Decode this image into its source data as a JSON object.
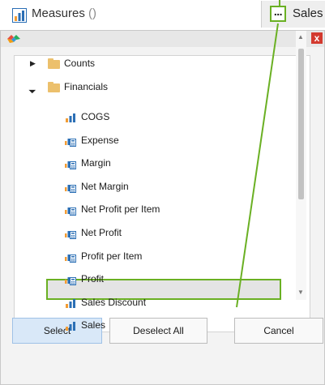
{
  "topbar": {
    "measures_label": "Measures",
    "measures_count": "()",
    "ellipsis": "...",
    "sales_tab_label": "Sales"
  },
  "dialog": {
    "close_glyph": "x",
    "tree": {
      "counts_label": "Counts",
      "financials_label": "Financials",
      "items": [
        {
          "label": "COGS",
          "icon": "bar-chart-icon"
        },
        {
          "label": "Expense",
          "icon": "calculated-measure-icon"
        },
        {
          "label": "Margin",
          "icon": "calculated-measure-icon"
        },
        {
          "label": "Net Margin",
          "icon": "calculated-measure-icon"
        },
        {
          "label": "Net Profit per Item",
          "icon": "calculated-measure-icon"
        },
        {
          "label": "Net Profit",
          "icon": "calculated-measure-icon"
        },
        {
          "label": "Profit per Item",
          "icon": "calculated-measure-icon"
        },
        {
          "label": "Profit",
          "icon": "calculated-measure-icon"
        },
        {
          "label": "Sales Discount",
          "icon": "bar-chart-icon"
        },
        {
          "label": "Sales",
          "icon": "bar-chart-icon"
        }
      ]
    },
    "buttons": {
      "select": "Select",
      "deselect_all": "Deselect All",
      "cancel": "Cancel"
    }
  },
  "colors": {
    "highlight_green": "#6ab023",
    "folder_yellow": "#ecc06c",
    "close_red": "#d33a2f"
  }
}
